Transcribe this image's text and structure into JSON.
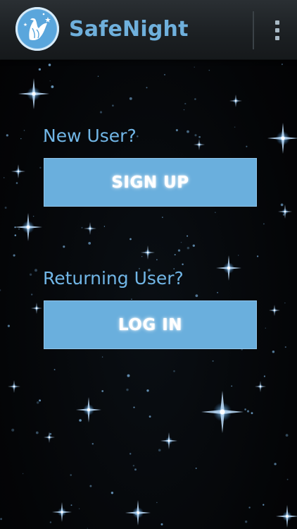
{
  "app_bar": {
    "title": "SafeNight",
    "logo_icon": "dove-logo-icon",
    "menu_icon": "overflow-menu-icon"
  },
  "sections": [
    {
      "prompt": "New User?",
      "button_label": "SIGN UP"
    },
    {
      "prompt": "Returning User?",
      "button_label": "LOG IN"
    }
  ],
  "colors": {
    "accent": "#6fb0dc",
    "button_fill": "#6aafdd",
    "background": "#050608",
    "app_bar": "#1b1f22"
  }
}
